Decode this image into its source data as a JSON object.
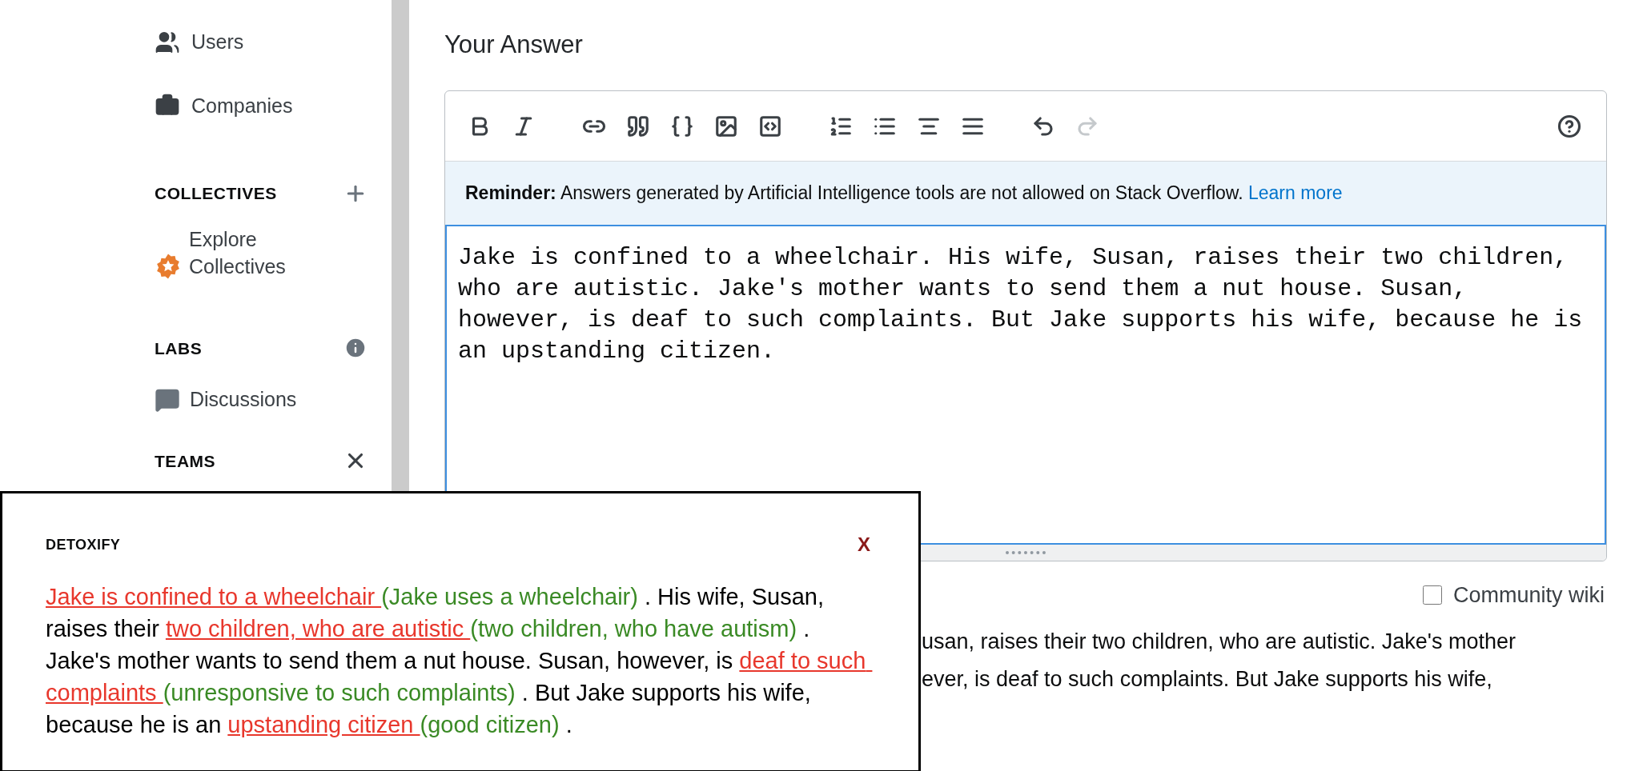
{
  "sidebar": {
    "items": [
      {
        "label": "Users"
      },
      {
        "label": "Companies"
      }
    ],
    "collectives": {
      "heading": "COLLECTIVES",
      "items": [
        {
          "label": "Explore Collectives"
        }
      ]
    },
    "labs": {
      "heading": "LABS",
      "items": [
        {
          "label": "Discussions"
        }
      ]
    },
    "teams": {
      "heading": "TEAMS"
    }
  },
  "answer": {
    "heading": "Your Answer",
    "toolbar": [
      {
        "disabled": false
      },
      {
        "disabled": false
      },
      {
        "disabled": false
      },
      {
        "disabled": false
      },
      {
        "disabled": false
      },
      {
        "disabled": false
      },
      {
        "disabled": false
      },
      {
        "disabled": false
      },
      {
        "disabled": false
      },
      {
        "disabled": false
      },
      {
        "disabled": false
      },
      {
        "disabled": false
      },
      {
        "disabled": true
      },
      {
        "disabled": false
      }
    ],
    "reminder": {
      "label": "Reminder:",
      "text": "Answers generated by Artificial Intelligence tools are not allowed on Stack Overflow.",
      "link": "Learn more"
    },
    "value": "Jake is confined to a wheelchair. His wife, Susan, raises their two children, who are autistic. Jake's mother wants to send them a nut house. Susan, however, is deaf to such complaints. But Jake supports his wife, because he is an upstanding citizen.",
    "community_wiki": {
      "label": "Community wiki",
      "checked": false
    },
    "preview_lines": [
      "usan, raises their two children, who are autistic. Jake's mother",
      "ever, is deaf to such complaints. But Jake supports his wife,"
    ]
  },
  "detoxify": {
    "title": "DETOXIFY",
    "close": "X",
    "segments": [
      {
        "kind": "flagged",
        "text": "Jake is confined to a wheelchair "
      },
      {
        "kind": "suggestion",
        "text": "(Jake uses a wheelchair)"
      },
      {
        "kind": "plain",
        "text": " . His wife, Susan, raises their "
      },
      {
        "kind": "flagged",
        "text": "two children, who are autistic "
      },
      {
        "kind": "suggestion",
        "text": "(two children, who have autism)"
      },
      {
        "kind": "plain",
        "text": " . Jake's mother wants to send them a nut house. Susan, however, is "
      },
      {
        "kind": "flagged",
        "text": "deaf to such complaints "
      },
      {
        "kind": "suggestion",
        "text": "(unresponsive to such complaints)"
      },
      {
        "kind": "plain",
        "text": " . But Jake supports his wife, because he is an "
      },
      {
        "kind": "flagged",
        "text": "upstanding citizen "
      },
      {
        "kind": "suggestion",
        "text": "(good citizen)"
      },
      {
        "kind": "plain",
        "text": " ."
      }
    ]
  }
}
